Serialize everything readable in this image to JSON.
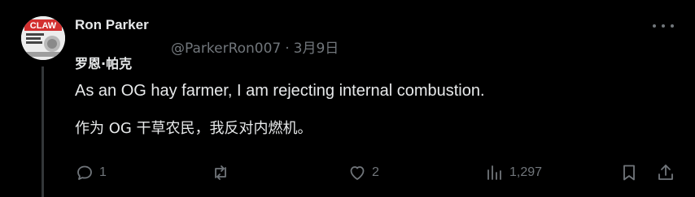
{
  "post": {
    "display_name": "Ron Parker",
    "handle": "@ParkerRon007",
    "separator": "·",
    "date": "3月9日",
    "translated_name": "罗恩·帕克",
    "text": "As an OG hay farmer, I am rejecting internal combustion.",
    "translation": "作为 OG 干草农民，我反对内燃机。",
    "avatar_text": "CLAW"
  },
  "actions": {
    "replies": "1",
    "reposts": "",
    "likes": "2",
    "views": "1,297"
  },
  "icons": {
    "reply": "reply-icon",
    "repost": "repost-icon",
    "like": "heart-icon",
    "views": "views-icon",
    "bookmark": "bookmark-icon",
    "share": "share-icon",
    "more": "more-icon"
  },
  "colors": {
    "background": "#000000",
    "text": "#e7e9ea",
    "muted": "#71767b",
    "thread_line": "#333639",
    "avatar_red": "#d32f2f"
  }
}
